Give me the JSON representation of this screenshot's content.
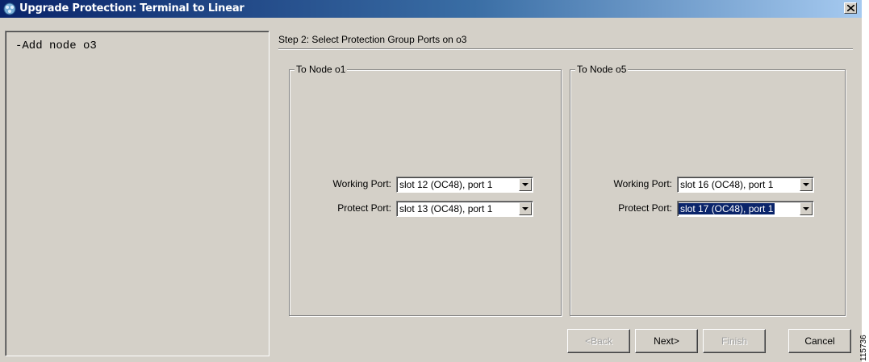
{
  "window": {
    "title": "Upgrade Protection: Terminal to Linear"
  },
  "log": {
    "text": "-Add node o3"
  },
  "step": {
    "label": "Step 2: Select Protection Group Ports on o3"
  },
  "groups": [
    {
      "legend": "To Node o1",
      "working_label": "Working Port:",
      "working_value": "slot 12 (OC48), port 1",
      "protect_label": "Protect Port:",
      "protect_value": "slot 13 (OC48), port 1"
    },
    {
      "legend": "To Node o5",
      "working_label": "Working Port:",
      "working_value": "slot 16 (OC48), port 1",
      "protect_label": "Protect Port:",
      "protect_value": "slot 17 (OC48), port 1"
    }
  ],
  "buttons": {
    "back": "<Back",
    "next": "Next>",
    "finish": "Finish",
    "cancel": "Cancel"
  },
  "side_id": "115736",
  "icons": {
    "app": "network-icon",
    "close": "close-icon",
    "dropdown": "chevron-down-icon"
  },
  "colors": {
    "titlebar_start": "#0a246a",
    "titlebar_end": "#a6caf0",
    "dialog_bg": "#d4d0c8",
    "selection": "#0a246a"
  }
}
